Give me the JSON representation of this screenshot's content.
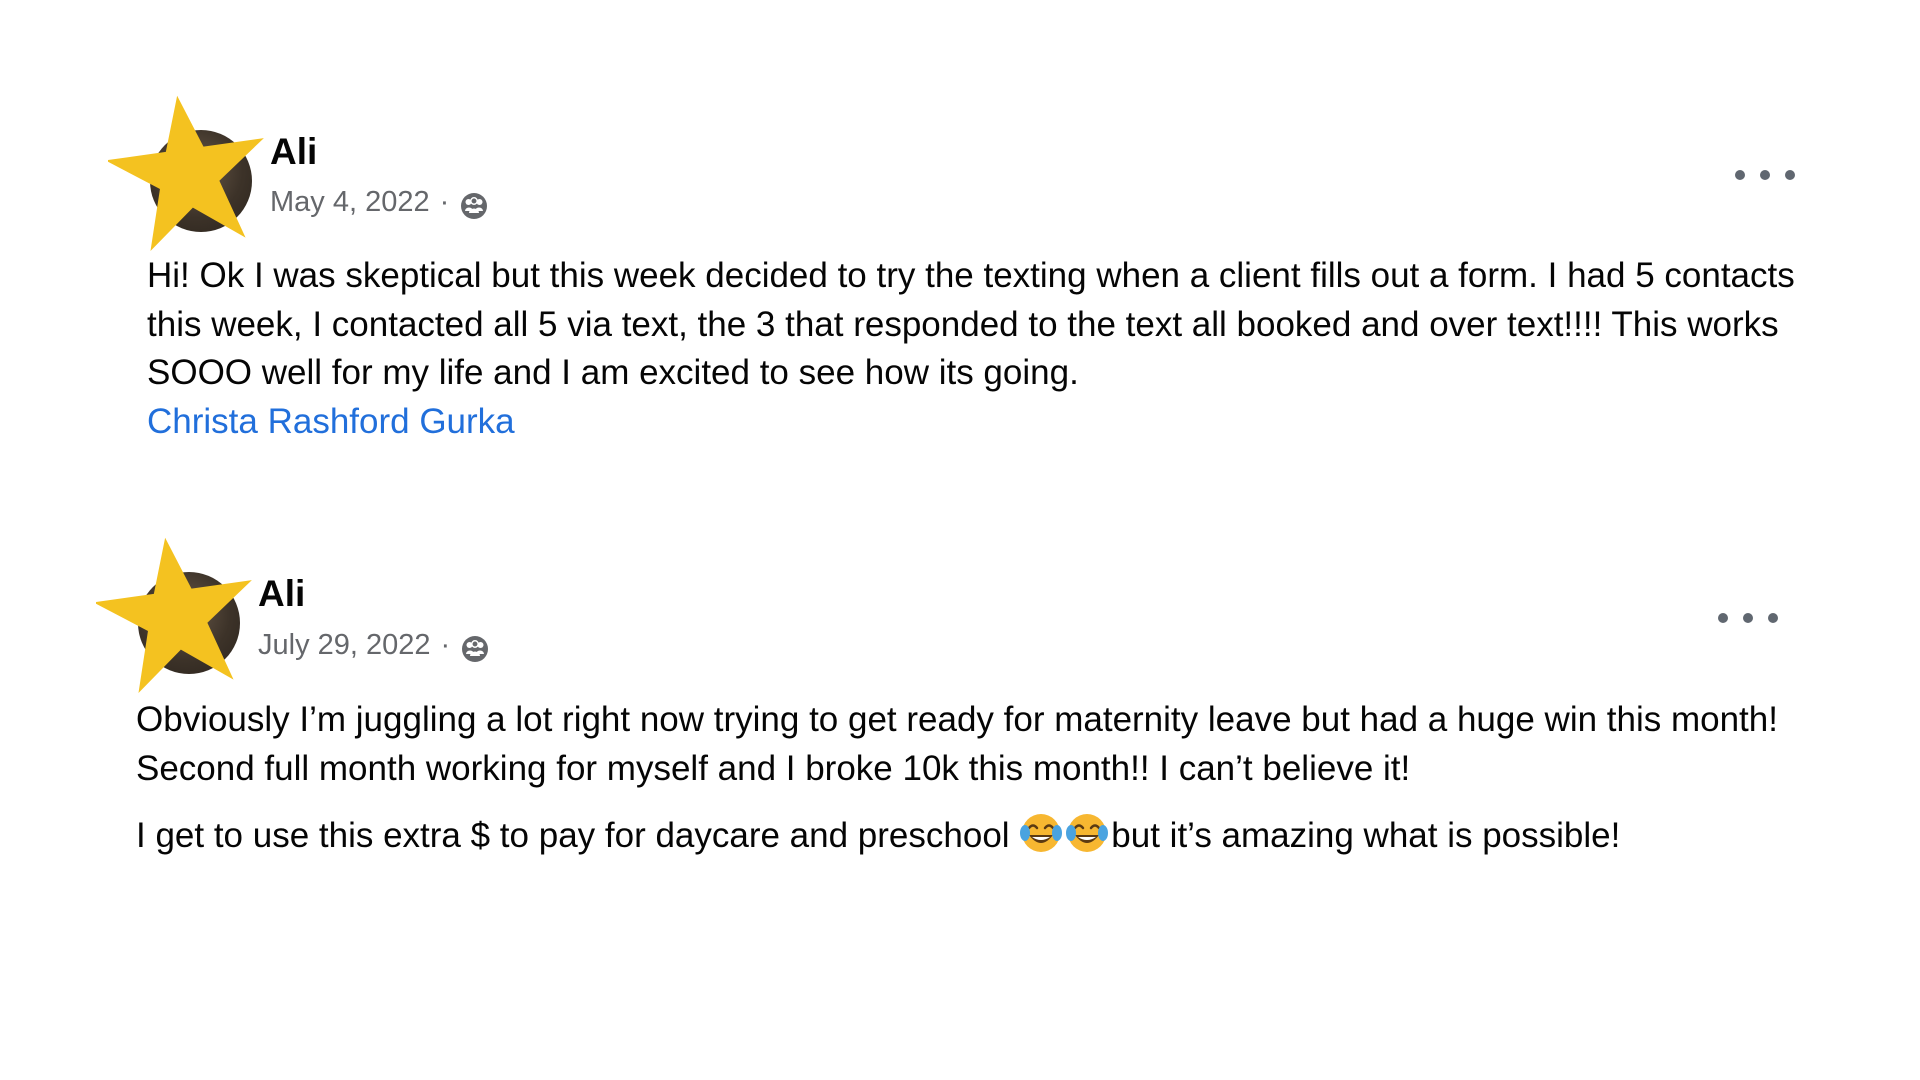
{
  "posts": [
    {
      "author": "Ali",
      "date": "May 4, 2022",
      "separator": "·",
      "audience_icon": "group-icon",
      "more_icon": "more-dots-icon",
      "body": "Hi! Ok I was skeptical but this week decided to try the texting when a client fills out a form. I had 5 contacts this week, I contacted all 5 via text, the 3 that responded to the text all booked and over text!!!! This works SOOO well for my life and I am excited to see how its going.",
      "mention": "Christa Rashford Gurka"
    },
    {
      "author": "Ali",
      "date": "July 29, 2022",
      "separator": "·",
      "audience_icon": "group-icon",
      "more_icon": "more-dots-icon",
      "line1": "Obviously I’m juggling a lot right now trying to get ready for maternity leave but had a huge win this month!",
      "line2": "Second full month working for myself and I broke 10k this month!! I can’t believe it!",
      "line3_before": "I get to use this extra $ to pay for daycare and preschool ",
      "emoji": "face-with-tears-of-joy-icon",
      "line3_after": "but it’s amazing what is possible!"
    }
  ],
  "colors": {
    "star": "#f4c220",
    "mention": "#216fdb",
    "meta": "#65676b",
    "text": "#050505"
  }
}
